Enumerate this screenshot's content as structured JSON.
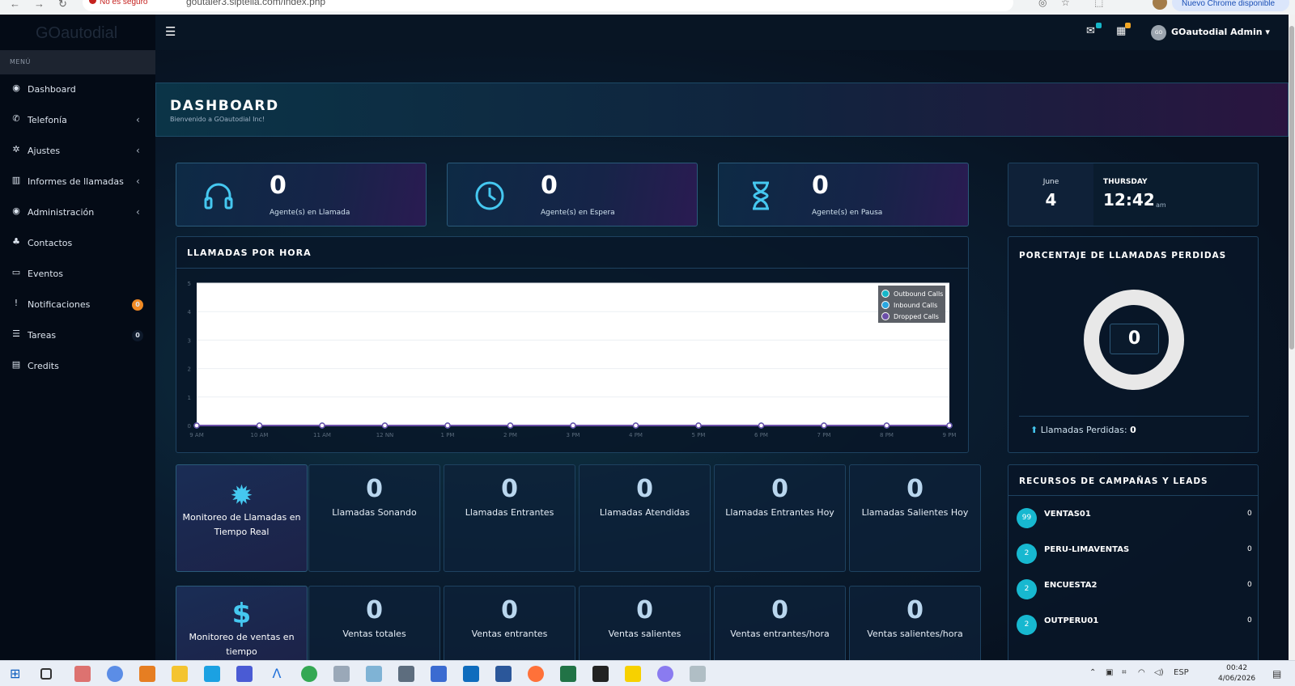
{
  "browser": {
    "security": "No es seguro",
    "url": "goutaler3.siptelia.com/index.php",
    "update_label": "Nuevo Chrome disponible"
  },
  "sidebar": {
    "logo": "GOautodial",
    "menu_header": "MENÚ",
    "items": [
      {
        "label": "Dashboard",
        "icon": "dashboard-icon",
        "chevron": false
      },
      {
        "label": "Telefonía",
        "icon": "phone-icon",
        "chevron": true
      },
      {
        "label": "Ajustes",
        "icon": "gear-icon",
        "chevron": true
      },
      {
        "label": "Informes de llamadas",
        "icon": "bar-chart-icon",
        "chevron": true
      },
      {
        "label": "Administración",
        "icon": "dashboard-icon",
        "chevron": true
      },
      {
        "label": "Contactos",
        "icon": "users-icon",
        "chevron": false
      },
      {
        "label": "Eventos",
        "icon": "calendar-icon",
        "chevron": false
      },
      {
        "label": "Notificaciones",
        "icon": "exclamation-icon",
        "badge": "0",
        "badge_color": "#f08a24"
      },
      {
        "label": "Tareas",
        "icon": "tasks-icon",
        "badge": "0",
        "badge_color": "#0e1a2b"
      },
      {
        "label": "Credits",
        "icon": "list-icon",
        "chevron": false
      }
    ]
  },
  "topbar": {
    "user": "GOautodial Admin",
    "avatar": "GO",
    "mail_badge": "0",
    "calendar_badge": "0"
  },
  "header": {
    "title": "DASHBOARD",
    "subtitle": "Bienvenido a GOautodial Inc!"
  },
  "stats": [
    {
      "value": "0",
      "label": "Agente(s) en Llamada",
      "icon": "headset-icon"
    },
    {
      "value": "0",
      "label": "Agente(s) en Espera",
      "icon": "clock-icon"
    },
    {
      "value": "0",
      "label": "Agente(s) en Pausa",
      "icon": "hourglass-icon"
    }
  ],
  "date_card": {
    "month": "June",
    "day": "4",
    "weekday": "THURSDAY",
    "time": "12:42",
    "ampm": "am"
  },
  "calls_chart": {
    "title": "LLAMADAS POR HORA"
  },
  "chart_data": {
    "type": "line",
    "categories": [
      "9 AM",
      "10 AM",
      "11 AM",
      "12 NN",
      "1 PM",
      "2 PM",
      "3 PM",
      "4 PM",
      "5 PM",
      "6 PM",
      "7 PM",
      "8 PM",
      "9 PM"
    ],
    "yticks": [
      "0",
      "1",
      "2",
      "3",
      "4",
      "5"
    ],
    "ylim": [
      0,
      5
    ],
    "series": [
      {
        "name": "Outbound Calls",
        "color": "#16b6c8",
        "values": [
          0,
          0,
          0,
          0,
          0,
          0,
          0,
          0,
          0,
          0,
          0,
          0,
          0
        ]
      },
      {
        "name": "Inbound Calls",
        "color": "#2aa7e0",
        "values": [
          0,
          0,
          0,
          0,
          0,
          0,
          0,
          0,
          0,
          0,
          0,
          0,
          0
        ]
      },
      {
        "name": "Dropped Calls",
        "color": "#6b4ea8",
        "values": [
          0,
          0,
          0,
          0,
          0,
          0,
          0,
          0,
          0,
          0,
          0,
          0,
          0
        ]
      }
    ],
    "legend": "top-right",
    "grid": true
  },
  "lost_panel": {
    "title": "PORCENTAJE DE LLAMADAS PERDIDAS",
    "donut_value": "0",
    "lost_label": "Llamadas Perdidas:",
    "lost_value": "0"
  },
  "realtime_row": {
    "first_label": "Monitoreo de Llamadas en Tiempo Real",
    "cards": [
      {
        "value": "0",
        "label": "Llamadas Sonando"
      },
      {
        "value": "0",
        "label": "Llamadas Entrantes"
      },
      {
        "value": "0",
        "label": "Llamadas Atendidas"
      },
      {
        "value": "0",
        "label": "Llamadas Entrantes Hoy"
      },
      {
        "value": "0",
        "label": "Llamadas Salientes Hoy"
      }
    ]
  },
  "sales_row": {
    "first_label": "Monitoreo de ventas en tiempo",
    "cards": [
      {
        "value": "0",
        "label": "Ventas totales"
      },
      {
        "value": "0",
        "label": "Ventas entrantes"
      },
      {
        "value": "0",
        "label": "Ventas salientes"
      },
      {
        "value": "0",
        "label": "Ventas entrantes/hora"
      },
      {
        "value": "0",
        "label": "Ventas salientes/hora"
      }
    ]
  },
  "campaigns": {
    "title": "RECURSOS DE CAMPAÑAS Y LEADS",
    "items": [
      {
        "avatar": "99",
        "name": "VENTAS01",
        "count": "0"
      },
      {
        "avatar": "2",
        "name": "PERU-LIMAVENTAS",
        "count": "0"
      },
      {
        "avatar": "2",
        "name": "ENCUESTA2",
        "count": "0"
      },
      {
        "avatar": "2",
        "name": "OUTPERU01",
        "count": "0"
      }
    ]
  },
  "taskbar": {
    "lang": "ESP",
    "time": "00:42",
    "date": "4/06/2026"
  }
}
